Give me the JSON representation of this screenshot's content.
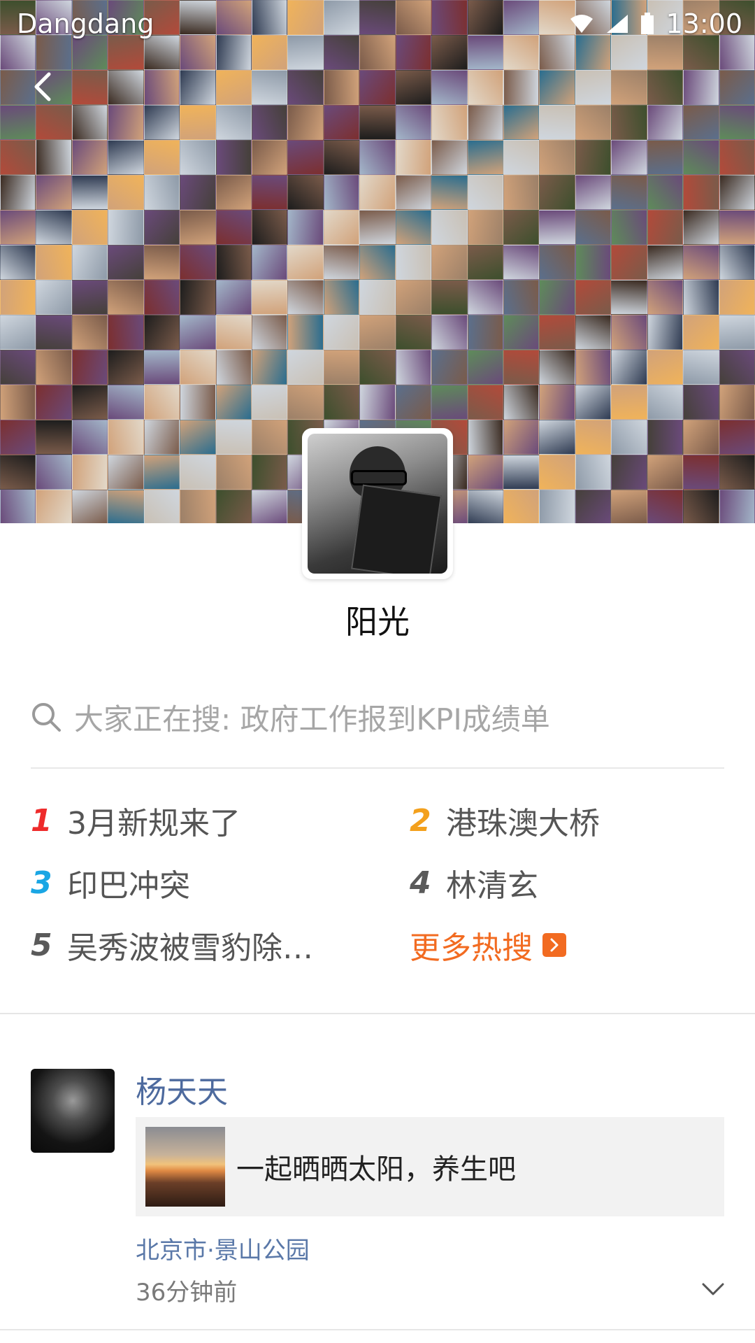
{
  "status_bar": {
    "carrier": "Dangdang",
    "time": "13:00"
  },
  "profile": {
    "name": "阳光"
  },
  "search": {
    "placeholder": "大家正在搜: 政府工作报到KPI成绩单"
  },
  "hot_searches": [
    {
      "rank": "1",
      "label": "3月新规来了"
    },
    {
      "rank": "2",
      "label": "港珠澳大桥"
    },
    {
      "rank": "3",
      "label": "印巴冲突"
    },
    {
      "rank": "4",
      "label": "林清玄"
    },
    {
      "rank": "5",
      "label": "吴秀波被雪豹除…"
    }
  ],
  "more_hot": {
    "label": "更多热搜"
  },
  "post": {
    "author": "杨天天",
    "text": "一起晒晒太阳，养生吧",
    "location": "北京市·景山公园",
    "time": "36分钟前"
  },
  "colors": {
    "rank1": "#ee2b2b",
    "rank2": "#f3a01c",
    "rank3": "#1aa6e4",
    "more_hot": "#f26b21",
    "link_blue": "#4d6a9e"
  }
}
